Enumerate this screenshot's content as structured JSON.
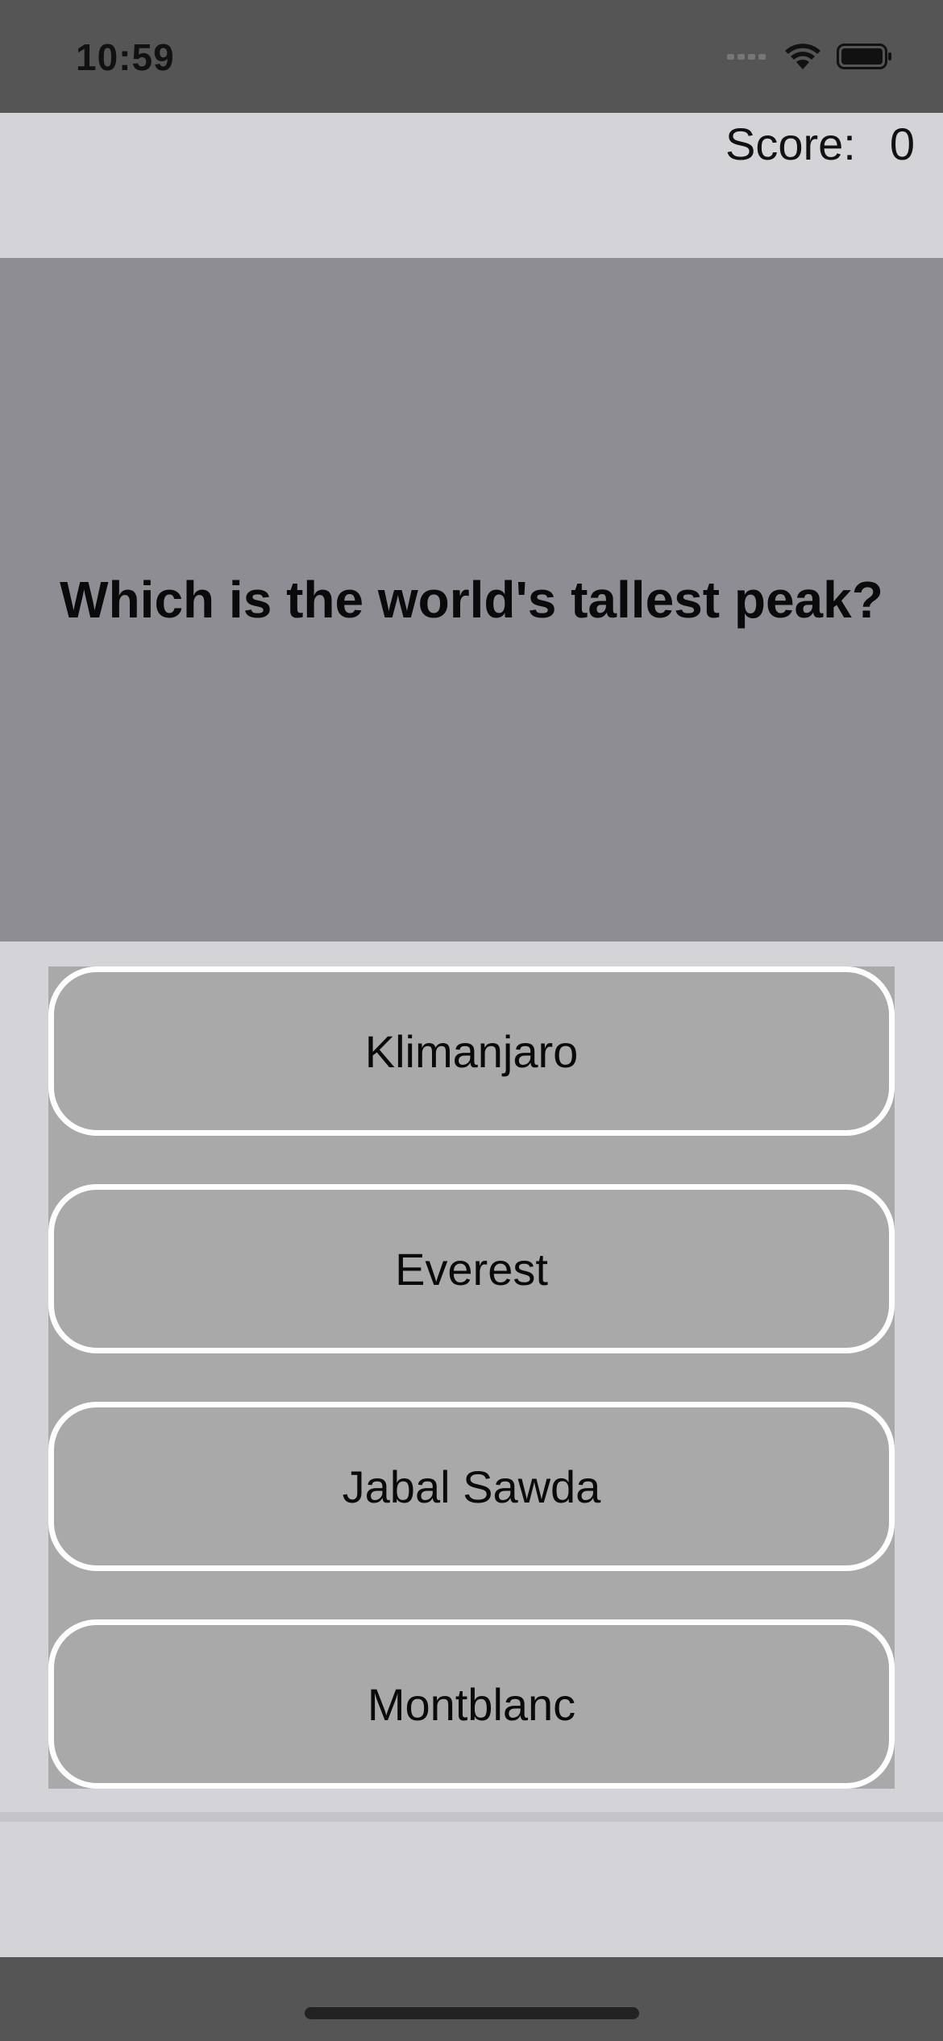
{
  "status_bar": {
    "time": "10:59",
    "icons": [
      "signal-icon",
      "wifi-icon",
      "battery-icon"
    ]
  },
  "score": {
    "label": "Score:",
    "value": "0"
  },
  "question": {
    "text": "Which is the world's tallest peak?"
  },
  "answers": [
    {
      "label": "Klimanjaro"
    },
    {
      "label": "Everest"
    },
    {
      "label": "Jabal Sawda"
    },
    {
      "label": "Montblanc"
    }
  ],
  "colors": {
    "background": "#d3d3d8",
    "system_bar": "#555555",
    "question_panel": "#8e8d93",
    "answer_fill": "#a9a9a9",
    "answer_border": "#ffffff"
  }
}
